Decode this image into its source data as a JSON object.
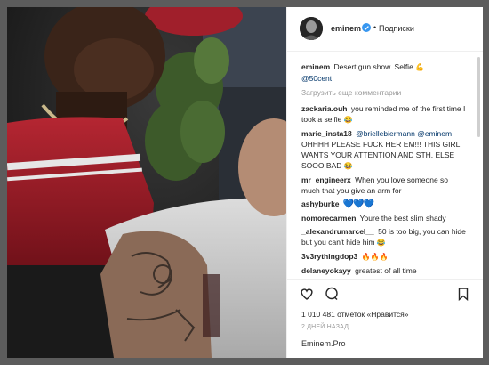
{
  "header": {
    "username": "eminem",
    "separator": "•",
    "follow_label": "Подписки"
  },
  "caption": {
    "username": "eminem",
    "text": "Desert gun show. Selfie",
    "emoji": "💪",
    "mention": "@50cent"
  },
  "load_more_label": "Загрузить еще комментарии",
  "comments": [
    {
      "username": "zackaria.ouh",
      "text": "you reminded me of the first time I took a selfie",
      "emoji": "😂"
    },
    {
      "username": "marie_insta18",
      "mention1": "@briellebiermann",
      "mention2": "@eminem",
      "text": "OHHHH PLEASE FUCK HER EM!!! THIS GIRL WANTS YOUR ATTENTION AND STH. ELSE SOOO BAD",
      "emoji": "😂"
    },
    {
      "username": "mr_engineerx",
      "text": "When you love someone so much that you give an arm for",
      "emoji": ""
    },
    {
      "username": "ashyburke",
      "text": "",
      "emoji": "💙💙💙"
    },
    {
      "username": "nomorecarmen",
      "text": "Youre the best slim shady",
      "emoji": ""
    },
    {
      "username": "_alexandrumarcel__",
      "text": "50 is too big, you can hide but you can't hide him",
      "emoji": "😂"
    },
    {
      "username": "3v3rythingdop3",
      "text": "",
      "emoji": "🔥🔥🔥"
    },
    {
      "username": "delaneyokayy",
      "text": "greatest of all time",
      "emoji": ""
    }
  ],
  "actions": {
    "like_icon": "heart-icon",
    "comment_icon": "comment-icon",
    "save_icon": "bookmark-icon"
  },
  "likes_text": "1 010 481 отметок «Нравится»",
  "time_ago": "2 ДНЕЙ НАЗАД",
  "watermark": "Eminem.Pro",
  "colors": {
    "verified": "#3897f0",
    "mention": "#003569",
    "muted": "#999999",
    "text": "#262626"
  }
}
